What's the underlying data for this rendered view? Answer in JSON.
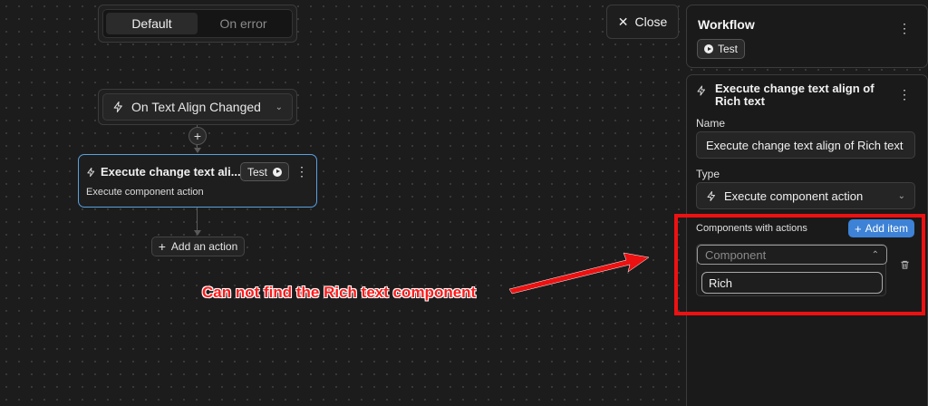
{
  "canvas": {
    "toggle": {
      "default_label": "Default",
      "on_error_label": "On error"
    },
    "trigger": {
      "label": "On Text Align Changed"
    },
    "action_card": {
      "title": "Execute change text ali...",
      "test_label": "Test",
      "subtitle": "Execute component action"
    },
    "add_action_label": "Add an action"
  },
  "close_label": "Close",
  "panel": {
    "workflow": {
      "title": "Workflow",
      "test_label": "Test"
    },
    "details": {
      "title": "Execute change text align of Rich text",
      "name_label": "Name",
      "name_value": "Execute change text align of Rich text",
      "type_label": "Type",
      "type_value": "Execute component action",
      "components_label": "Components with actions",
      "add_item_label": "Add item",
      "component_placeholder": "Component",
      "search_value": "Rich"
    }
  },
  "annotation": {
    "text": "Can not find the Rich text component",
    "color": "#ee1111"
  }
}
